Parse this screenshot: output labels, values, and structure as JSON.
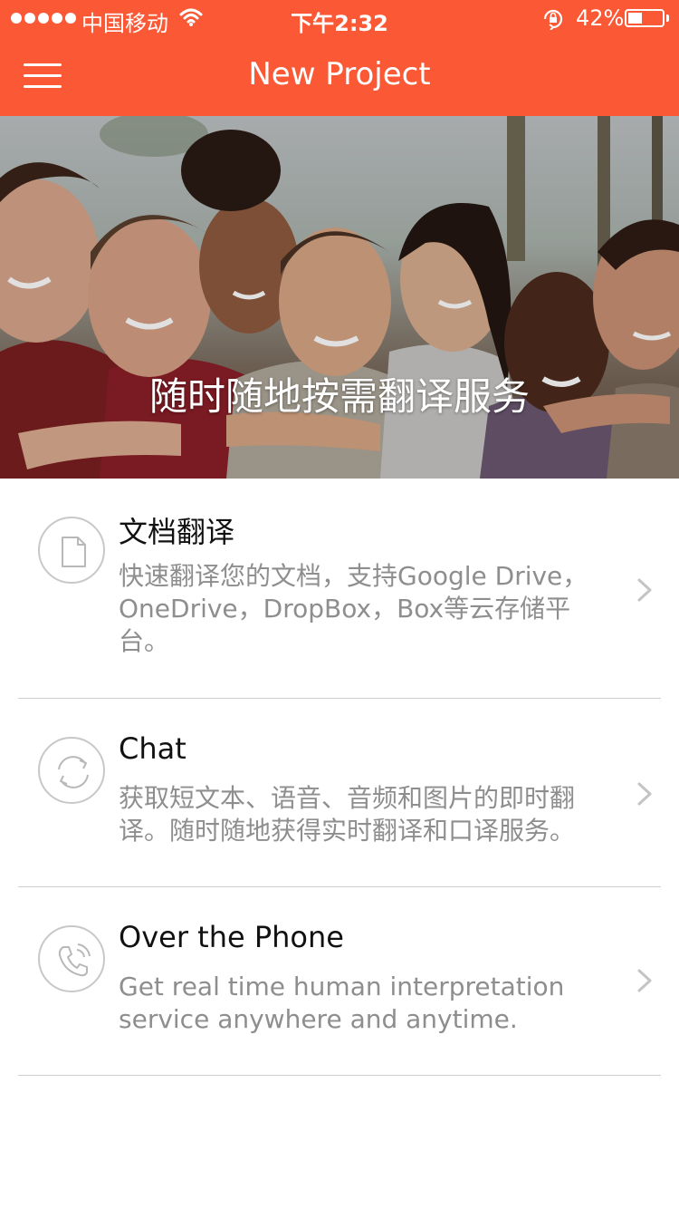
{
  "status_bar": {
    "carrier": "中国移动",
    "time": "下午2:32",
    "battery": "42%",
    "battery_level": 0.42,
    "icons": [
      "signal-icon",
      "wifi-icon",
      "rotation-lock-icon",
      "battery-icon"
    ]
  },
  "nav": {
    "title": "New Project",
    "menu_icon": "hamburger-menu-icon"
  },
  "hero": {
    "caption": "随时随地按需翻译服务"
  },
  "services": [
    {
      "icon": "document-icon",
      "title": "文档翻译",
      "description": "快速翻译您的文档，支持Google Drive，OneDrive，DropBox，Box等云存储平台。"
    },
    {
      "icon": "refresh-chat-icon",
      "title": "Chat",
      "description": "获取短文本、语音、音频和图片的即时翻译。随时随地获得实时翻译和口译服务。"
    },
    {
      "icon": "phone-icon",
      "title": "Over the Phone",
      "description": "Get real time human interpretation service anywhere and anytime."
    }
  ],
  "colors": {
    "accent": "#fb5936",
    "divider": "#cfcfcf",
    "title": "#111111",
    "description": "#8e8e8e"
  }
}
